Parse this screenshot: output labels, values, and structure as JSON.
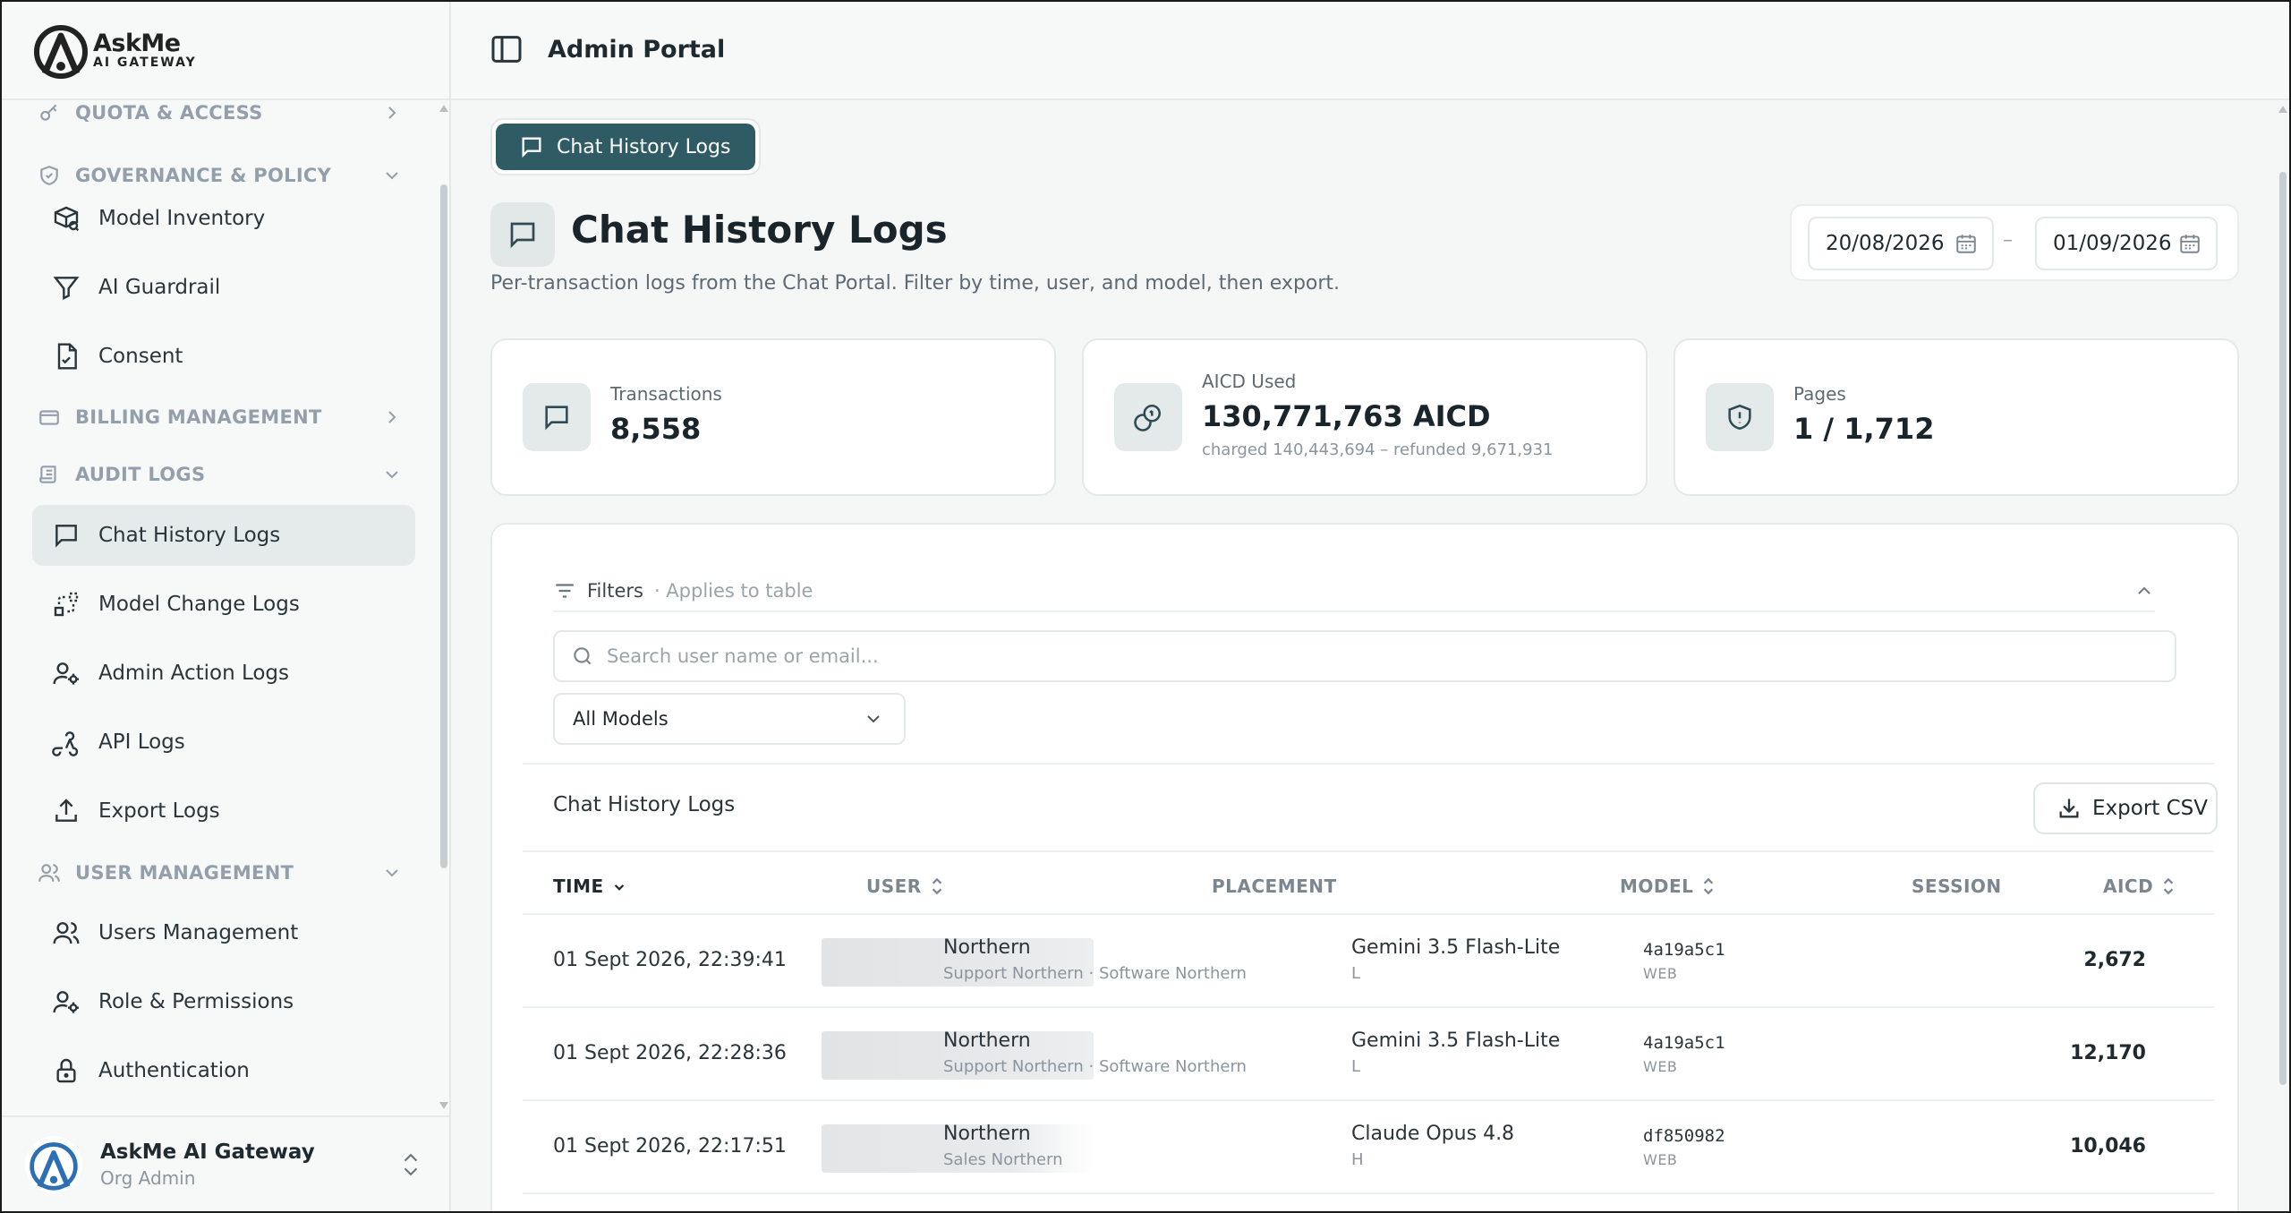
{
  "brand": {
    "name_line1": "AskMe",
    "name_line2": "AI GATEWAY"
  },
  "header": {
    "title": "Admin Portal"
  },
  "sidebar": {
    "sections": [
      {
        "label": "QUOTA & ACCESS",
        "icon": "key-icon",
        "expanded": false
      },
      {
        "label": "GOVERNANCE & POLICY",
        "icon": "shield-check-icon",
        "expanded": true
      },
      {
        "label": "BILLING MANAGEMENT",
        "icon": "credit-card-icon",
        "expanded": false
      },
      {
        "label": "AUDIT LOGS",
        "icon": "scroll-icon",
        "expanded": true
      },
      {
        "label": "USER MANAGEMENT",
        "icon": "users-icon",
        "expanded": true
      }
    ],
    "items": [
      {
        "label": "Model Inventory",
        "icon": "package-search-icon"
      },
      {
        "label": "AI Guardrail",
        "icon": "funnel-icon"
      },
      {
        "label": "Consent",
        "icon": "document-check-icon"
      },
      {
        "label": "Chat History Logs",
        "icon": "message-square-icon",
        "active": true
      },
      {
        "label": "Model Change Logs",
        "icon": "git-compare-icon"
      },
      {
        "label": "Admin Action Logs",
        "icon": "user-cog-icon"
      },
      {
        "label": "API Logs",
        "icon": "webhook-icon"
      },
      {
        "label": "Export Logs",
        "icon": "upload-icon"
      },
      {
        "label": "Users Management",
        "icon": "users-icon"
      },
      {
        "label": "Role & Permissions",
        "icon": "user-cog-icon"
      },
      {
        "label": "Authentication",
        "icon": "lock-icon"
      }
    ],
    "footer": {
      "name": "AskMe AI Gateway",
      "role": "Org Admin"
    }
  },
  "tabs": [
    {
      "label": "Chat History Logs",
      "active": true
    }
  ],
  "page": {
    "title": "Chat History Logs",
    "subtitle": "Per-transaction logs from the Chat Portal. Filter by time, user, and model, then export.",
    "date_from": "20/08/2026",
    "date_separator": "–",
    "date_to": "01/09/2026"
  },
  "stats": [
    {
      "label": "Transactions",
      "value": "8,558",
      "icon": "message-square-icon"
    },
    {
      "label": "AICD Used",
      "value": "130,771,763 AICD",
      "note": "charged 140,443,694 – refunded 9,671,931",
      "icon": "coins-icon"
    },
    {
      "label": "Pages",
      "value": "1 / 1,712",
      "icon": "shield-alert-icon"
    }
  ],
  "filters": {
    "label": "Filters",
    "hint": "· Applies to table",
    "search_placeholder": "Search user name or email...",
    "search_value": "",
    "model_select": "All Models"
  },
  "table": {
    "title": "Chat History Logs",
    "export_label": "Export CSV",
    "columns": {
      "time": "TIME",
      "user": "USER",
      "placement": "PLACEMENT",
      "model": "MODEL",
      "session": "SESSION",
      "aicd": "AICD"
    },
    "rows": [
      {
        "time": "01 Sept 2026, 22:39:41",
        "placement": "Northern",
        "placement_sub": "Support Northern · Software Northern",
        "model": "Gemini 3.5 Flash-Lite",
        "model_tier": "L",
        "session": "4a19a5c1",
        "channel": "WEB",
        "aicd": "2,672"
      },
      {
        "time": "01 Sept 2026, 22:28:36",
        "placement": "Northern",
        "placement_sub": "Support Northern · Software Northern",
        "model": "Gemini 3.5 Flash-Lite",
        "model_tier": "L",
        "session": "4a19a5c1",
        "channel": "WEB",
        "aicd": "12,170"
      },
      {
        "time": "01 Sept 2026, 22:17:51",
        "placement": "Northern",
        "placement_sub": "Sales Northern",
        "model": "Claude Opus 4.8",
        "model_tier": "H",
        "session": "df850982",
        "channel": "WEB",
        "aicd": "10,046"
      }
    ]
  },
  "colors": {
    "accent": "#2f5c64",
    "active_bg": "#e4ebea",
    "muted": "#93a0ab"
  }
}
